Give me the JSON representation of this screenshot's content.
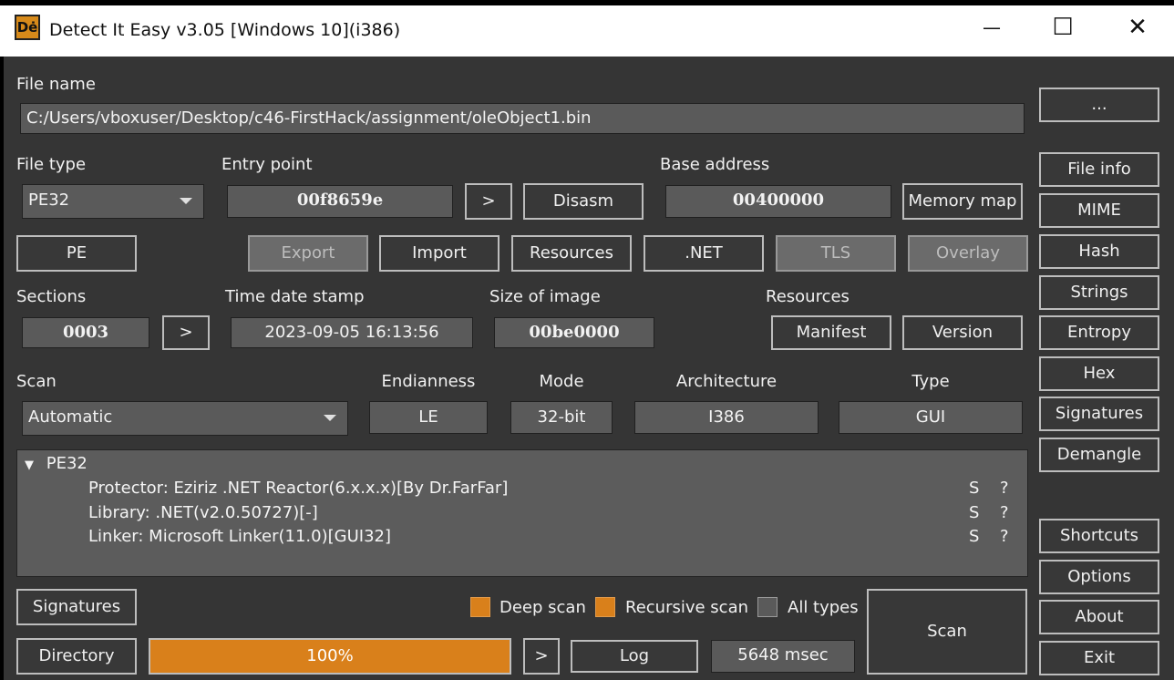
{
  "window": {
    "title": "Detect It Easy v3.05 [Windows 10](i386)",
    "icon_text": "Dė",
    "minimize": "—",
    "maximize": "☐",
    "close": "✕"
  },
  "file": {
    "label": "File name",
    "path": "C:/Users/vboxuser/Desktop/c46-FirstHack/assignment/oleObject1.bin",
    "browse_label": "..."
  },
  "file_type": {
    "label": "File type",
    "value": "PE32"
  },
  "entry_point": {
    "label": "Entry point",
    "value": "00f8659e",
    "go_label": ">",
    "disasm_label": "Disasm"
  },
  "base_address": {
    "label": "Base address",
    "value": "00400000",
    "memory_map_label": "Memory map"
  },
  "pe_buttons": {
    "pe": "PE",
    "export": "Export",
    "import": "Import",
    "resources": "Resources",
    "net": ".NET",
    "tls": "TLS",
    "overlay": "Overlay"
  },
  "sections": {
    "label": "Sections",
    "value": "0003",
    "go_label": ">"
  },
  "time_date_stamp": {
    "label": "Time date stamp",
    "value": "2023-09-05 16:13:56"
  },
  "size_of_image": {
    "label": "Size of image",
    "value": "00be0000"
  },
  "resources_group": {
    "label": "Resources",
    "manifest": "Manifest",
    "version": "Version"
  },
  "scan": {
    "label": "Scan",
    "mode_value": "Automatic"
  },
  "info": {
    "endianness_label": "Endianness",
    "endianness": "LE",
    "mode_label": "Mode",
    "mode": "32-bit",
    "architecture_label": "Architecture",
    "architecture": "I386",
    "type_label": "Type",
    "type": "GUI"
  },
  "results": {
    "root": "PE32",
    "expander": "▼",
    "rows": [
      {
        "text": "Protector: Eziriz .NET Reactor(6.x.x.x)[By Dr.FarFar]",
        "s": "S",
        "q": "?"
      },
      {
        "text": "Library: .NET(v2.0.50727)[-]",
        "s": "S",
        "q": "?"
      },
      {
        "text": "Linker: Microsoft Linker(11.0)[GUI32]",
        "s": "S",
        "q": "?"
      }
    ]
  },
  "bottom": {
    "signatures": "Signatures",
    "directory": "Directory",
    "deep_scan": "Deep scan",
    "recursive_scan": "Recursive scan",
    "all_types": "All types",
    "progress_text": "100%",
    "progress_value": 100,
    "go_label": ">",
    "log": "Log",
    "time": "5648 msec",
    "scan": "Scan"
  },
  "side": {
    "file_info": "File info",
    "mime": "MIME",
    "hash": "Hash",
    "strings": "Strings",
    "entropy": "Entropy",
    "hex": "Hex",
    "signatures": "Signatures",
    "demangle": "Demangle",
    "shortcuts": "Shortcuts",
    "options": "Options",
    "about": "About",
    "exit": "Exit"
  },
  "colors": {
    "accent": "#d9801b",
    "background": "#353535",
    "field": "#5a5a5a"
  }
}
